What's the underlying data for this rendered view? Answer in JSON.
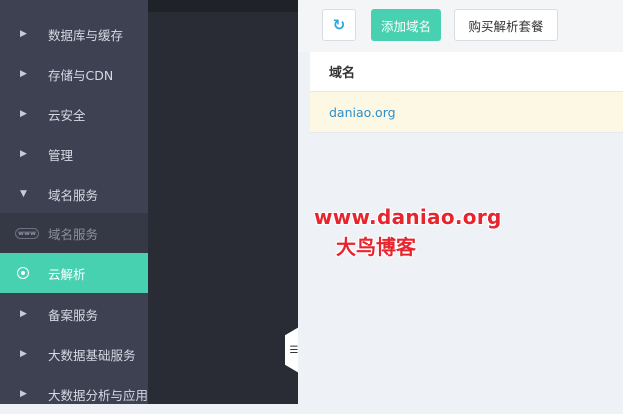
{
  "sidebar": {
    "items": [
      {
        "label": "数据库与缓存",
        "icon": "caret-right-icon",
        "state": "normal"
      },
      {
        "label": "存储与CDN",
        "icon": "caret-right-icon",
        "state": "normal"
      },
      {
        "label": "云安全",
        "icon": "caret-right-icon",
        "state": "normal"
      },
      {
        "label": "管理",
        "icon": "caret-right-icon",
        "state": "normal"
      },
      {
        "label": "域名服务",
        "icon": "caret-down-icon",
        "state": "expanded"
      },
      {
        "label": "域名服务",
        "icon": "www-icon",
        "state": "sub",
        "icon_text": "www"
      },
      {
        "label": "云解析",
        "icon": "dns-ring-icon",
        "state": "active"
      },
      {
        "label": "备案服务",
        "icon": "caret-right-icon",
        "state": "normal"
      },
      {
        "label": "大数据基础服务",
        "icon": "caret-right-icon",
        "state": "normal"
      },
      {
        "label": "大数据分析与应用",
        "icon": "caret-right-icon",
        "state": "normal"
      }
    ]
  },
  "toolbar": {
    "refresh_icon": "refresh-icon",
    "add_domain_label": "添加域名",
    "buy_package_label": "购买解析套餐"
  },
  "table": {
    "header": "域名",
    "rows": [
      {
        "domain": "daniao.org"
      }
    ]
  },
  "watermark": {
    "url": "www.daniao.org",
    "name": "大鸟博客"
  },
  "colors": {
    "accent": "#48d1b1",
    "sidebar_bg": "#3d4152",
    "link": "#2d8fcc",
    "highlight_row": "#fcf8e3",
    "watermark": "#e8242e"
  }
}
